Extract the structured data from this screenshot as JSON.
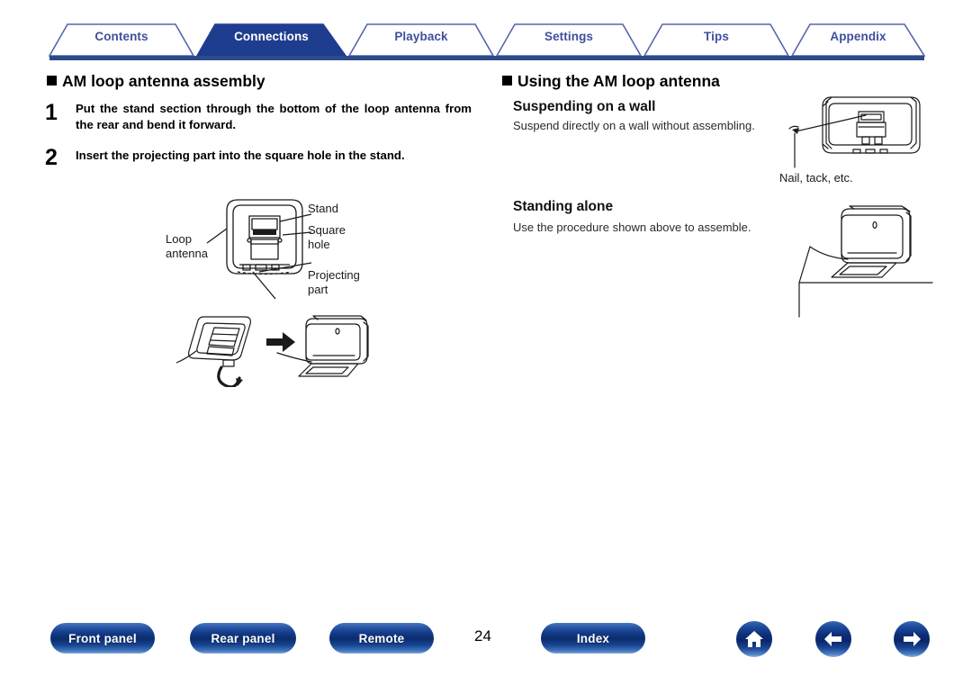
{
  "nav": {
    "tabs": [
      {
        "label": "Contents",
        "active": false
      },
      {
        "label": "Connections",
        "active": true
      },
      {
        "label": "Playback",
        "active": false
      },
      {
        "label": "Settings",
        "active": false
      },
      {
        "label": "Tips",
        "active": false
      },
      {
        "label": "Appendix",
        "active": false
      }
    ],
    "active_color": "#1f3d8f",
    "inactive_text_color": "#3f4f9c",
    "rule_color": "#2d4a8a"
  },
  "left_column": {
    "heading": "AM loop antenna assembly",
    "steps": [
      {
        "number": "1",
        "text": "Put the stand section through the bottom of the loop antenna from the rear and bend it forward."
      },
      {
        "number": "2",
        "text": "Insert the projecting part into the square hole in the stand."
      }
    ],
    "diagram_labels": {
      "stand": "Stand",
      "square_hole": "Square\nhole",
      "loop_antenna": "Loop\nantenna",
      "projecting_part": "Projecting\npart"
    }
  },
  "right_column": {
    "heading": "Using the AM loop antenna",
    "sections": [
      {
        "title": "Suspending on a wall",
        "body": "Suspend directly on a wall without assembling.",
        "caption": "Nail, tack, etc."
      },
      {
        "title": "Standing alone",
        "body": "Use the procedure shown above to assemble.",
        "caption": ""
      }
    ]
  },
  "footer": {
    "buttons": [
      {
        "label": "Front panel"
      },
      {
        "label": "Rear panel"
      },
      {
        "label": "Remote"
      },
      {
        "label": "Index"
      }
    ],
    "page_number": "24",
    "icons": [
      {
        "name": "home-icon"
      },
      {
        "name": "arrow-left-icon"
      },
      {
        "name": "arrow-right-icon"
      }
    ]
  }
}
